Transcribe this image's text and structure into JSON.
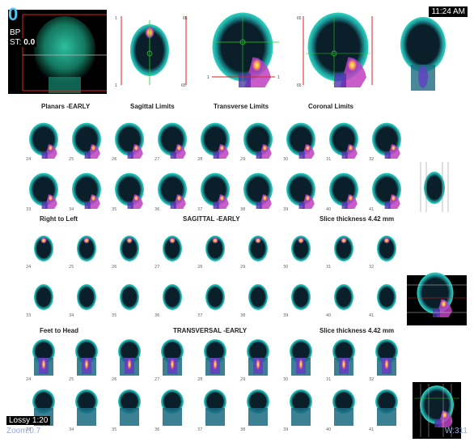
{
  "hud": {
    "study_id": "0",
    "bp": "BP",
    "st_label": "ST:",
    "st_value": "0.0",
    "time": "11:24 AM",
    "lossy": "Lossy 1:20",
    "zoom": "Zoom:0.7",
    "wl": "W:311"
  },
  "top_row": {
    "labels": [
      "Planars -EARLY",
      "Sagittal Limits",
      "Transverse Limits",
      "Coronal Limits"
    ],
    "sagittal_limits": {
      "top": "1",
      "top_right": "65",
      "bottom": "1",
      "bottom_right": "65"
    },
    "transverse_limits": {
      "left": "1",
      "right": "1"
    },
    "coronal_limits": {
      "top": "65",
      "bottom": "65"
    }
  },
  "sagittal": {
    "label_left": "Right to Left",
    "label_center": "SAGITTAL -EARLY",
    "label_right": "Slice thickness 4.42 mm",
    "row1": [
      "24",
      "25",
      "26",
      "27",
      "28",
      "29",
      "30",
      "31",
      "32"
    ],
    "row2": [
      "33",
      "34",
      "35",
      "36",
      "37",
      "38",
      "39",
      "40",
      "41"
    ]
  },
  "transverse": {
    "label_left": "Feet to Head",
    "label_center": "TRANSVERSAL -EARLY",
    "label_right": "Slice thickness 4.42 mm",
    "row1": [
      "24",
      "25",
      "26",
      "27",
      "28",
      "29",
      "30",
      "31",
      "32"
    ],
    "row2": [
      "33",
      "34",
      "35",
      "36",
      "37",
      "38",
      "39",
      "40",
      "41"
    ]
  },
  "coronal": {
    "row1": [
      "24",
      "25",
      "26",
      "27",
      "28",
      "29",
      "30",
      "31",
      "32"
    ],
    "row2": [
      "33",
      "34",
      "35",
      "36",
      "37",
      "38",
      "39",
      "40",
      "41"
    ]
  },
  "colors": {
    "background": "#ffffff",
    "scan_outline": "#20c0b0",
    "hot": "#ffd24a",
    "mid": "#c040c0",
    "low": "#3050c0",
    "limit_line": "#dd2222",
    "crosshair": "#22cc22",
    "hud_id": "#4fc3f7"
  }
}
